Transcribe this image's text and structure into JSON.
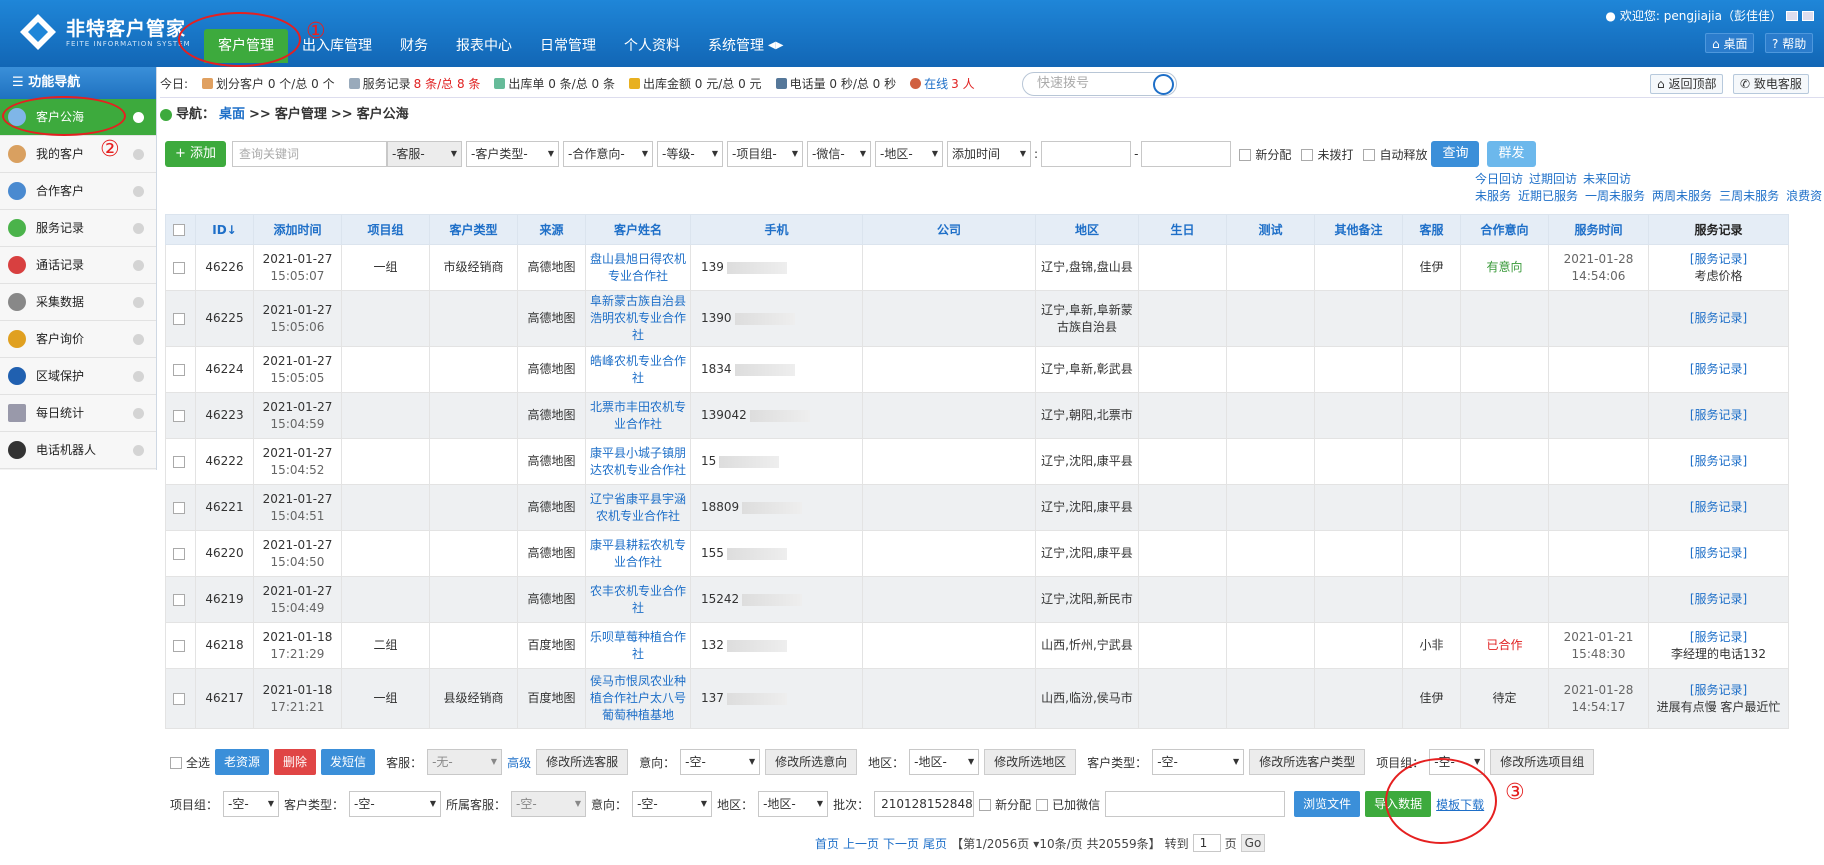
{
  "app": {
    "title": "非特客户管家",
    "subtitle": "FEITE INFORMATION SYSTEM"
  },
  "nav": {
    "tabs": [
      "客户管理",
      "出入库管理",
      "财务",
      "报表中心",
      "日常管理",
      "个人资料",
      "系统管理"
    ],
    "active": "客户管理"
  },
  "header": {
    "welcome": "欢迎您: pengjiajia（彭佳佳）",
    "desktop": "桌面",
    "help": "帮助"
  },
  "sidebar": {
    "title": "功能导航",
    "items": [
      "客户公海",
      "我的客户",
      "合作客户",
      "服务记录",
      "通话记录",
      "采集数据",
      "客户询价",
      "区域保护",
      "每日统计",
      "电话机器人"
    ],
    "active": "客户公海"
  },
  "stats": {
    "today": "今日:",
    "assign": "划分客户 0 个/总 0 个",
    "service_label": "服务记录",
    "service_val": "8 条/总 8 条",
    "outbound": "出库单 0 条/总 0 条",
    "amount": "出库金额 0 元/总 0 元",
    "calls": "电话量 0 秒/总 0 秒",
    "online_label": "在线",
    "online_val": "3 人"
  },
  "dial": {
    "placeholder": "快速拨号"
  },
  "right_buttons": {
    "back_top": "返回顶部",
    "call_service": "致电客服"
  },
  "breadcrumb": {
    "label": "导航：",
    "home": "桌面",
    "sep": ">>",
    "p1": "客户管理",
    "p2": "客户公海"
  },
  "filters": {
    "add": "+ 添加",
    "keyword_placeholder": "查询关键词",
    "selects": [
      "-客服-",
      "-客户类型-",
      "-合作意向-",
      "-等级-",
      "-项目组-",
      "-微信-",
      "-地区-",
      "添加时间"
    ],
    "colon": ":",
    "dash": "-",
    "checks": [
      "新分配",
      "未拨打",
      "自动释放"
    ],
    "query": "查询",
    "bulk": "群发"
  },
  "quick_links": {
    "row1": [
      "今日回访",
      "过期回访",
      "未来回访"
    ],
    "row2": [
      "未服务",
      "近期已服务",
      "一周未服务",
      "两周未服务",
      "三周未服务",
      "浪费资"
    ]
  },
  "table": {
    "headers": [
      "ID↓",
      "添加时间",
      "项目组",
      "客户类型",
      "来源",
      "客户姓名",
      "手机",
      "公司",
      "地区",
      "生日",
      "测试",
      "其他备注",
      "客服",
      "合作意向",
      "服务时间",
      "服务记录"
    ],
    "rows": [
      {
        "id": "46226",
        "date": "2021-01-27",
        "time": "15:05:07",
        "group": "一组",
        "type": "市级经销商",
        "src": "高德地图",
        "name": "盘山县旭日得农机专业合作社",
        "phone": "139",
        "region": "辽宁,盘锦,盘山县",
        "cs": "佳伊",
        "intent": "有意向",
        "sdate": "2021-01-28",
        "stime": "14:54:06",
        "rec": "[服务记录]",
        "note": "考虑价格"
      },
      {
        "id": "46225",
        "date": "2021-01-27",
        "time": "15:05:06",
        "group": "",
        "type": "",
        "src": "高德地图",
        "name": "阜新蒙古族自治县浩明农机专业合作社",
        "phone": "1390",
        "region": "辽宁,阜新,阜新蒙古族自治县",
        "cs": "",
        "intent": "",
        "sdate": "",
        "stime": "",
        "rec": "[服务记录]",
        "note": ""
      },
      {
        "id": "46224",
        "date": "2021-01-27",
        "time": "15:05:05",
        "group": "",
        "type": "",
        "src": "高德地图",
        "name": "皓峰农机专业合作社",
        "phone": "1834",
        "region": "辽宁,阜新,彰武县",
        "cs": "",
        "intent": "",
        "sdate": "",
        "stime": "",
        "rec": "[服务记录]",
        "note": ""
      },
      {
        "id": "46223",
        "date": "2021-01-27",
        "time": "15:04:59",
        "group": "",
        "type": "",
        "src": "高德地图",
        "name": "北票市丰田农机专业合作社",
        "phone": "139042",
        "region": "辽宁,朝阳,北票市",
        "cs": "",
        "intent": "",
        "sdate": "",
        "stime": "",
        "rec": "[服务记录]",
        "note": ""
      },
      {
        "id": "46222",
        "date": "2021-01-27",
        "time": "15:04:52",
        "group": "",
        "type": "",
        "src": "高德地图",
        "name": "康平县小城子镇朋达农机专业合作社",
        "phone": "15",
        "region": "辽宁,沈阳,康平县",
        "cs": "",
        "intent": "",
        "sdate": "",
        "stime": "",
        "rec": "[服务记录]",
        "note": ""
      },
      {
        "id": "46221",
        "date": "2021-01-27",
        "time": "15:04:51",
        "group": "",
        "type": "",
        "src": "高德地图",
        "name": "辽宁省康平县宇涵农机专业合作社",
        "phone": "18809",
        "region": "辽宁,沈阳,康平县",
        "cs": "",
        "intent": "",
        "sdate": "",
        "stime": "",
        "rec": "[服务记录]",
        "note": ""
      },
      {
        "id": "46220",
        "date": "2021-01-27",
        "time": "15:04:50",
        "group": "",
        "type": "",
        "src": "高德地图",
        "name": "康平县耕耘农机专业合作社",
        "phone": "155",
        "region": "辽宁,沈阳,康平县",
        "cs": "",
        "intent": "",
        "sdate": "",
        "stime": "",
        "rec": "[服务记录]",
        "note": ""
      },
      {
        "id": "46219",
        "date": "2021-01-27",
        "time": "15:04:49",
        "group": "",
        "type": "",
        "src": "高德地图",
        "name": "农丰农机专业合作社",
        "phone": "15242",
        "region": "辽宁,沈阳,新民市",
        "cs": "",
        "intent": "",
        "sdate": "",
        "stime": "",
        "rec": "[服务记录]",
        "note": ""
      },
      {
        "id": "46218",
        "date": "2021-01-18",
        "time": "17:21:29",
        "group": "二组",
        "type": "",
        "src": "百度地图",
        "name": "乐呗草莓种植合作社",
        "phone": "132",
        "region": "山西,忻州,宁武县",
        "cs": "小非",
        "intent": "已合作",
        "sdate": "2021-01-21",
        "stime": "15:48:30",
        "rec": "[服务记录]",
        "note": "李经理的电话132"
      },
      {
        "id": "46217",
        "date": "2021-01-18",
        "time": "17:21:21",
        "group": "一组",
        "type": "县级经销商",
        "src": "百度地图",
        "name": "侯马市恨凤农业种植合作社户太八号葡萄种植基地",
        "phone": "137",
        "region": "山西,临汾,侯马市",
        "cs": "佳伊",
        "intent": "待定",
        "sdate": "2021-01-28",
        "stime": "14:54:17",
        "rec": "[服务记录]",
        "note": "进展有点慢 客户最近忙"
      }
    ]
  },
  "actions1": {
    "select_all": "全选",
    "old": "老资源",
    "delete": "删除",
    "sms": "发短信",
    "cs_label": "客服：",
    "cs_val": "-无-",
    "advanced": "高级",
    "mod_cs": "修改所选客服",
    "intent_label": "意向：",
    "intent_val": "-空-",
    "mod_intent": "修改所选意向",
    "region_label": "地区：",
    "region_val": "-地区-",
    "mod_region": "修改所选地区",
    "type_label": "客户类型：",
    "type_val": "-空-",
    "mod_type": "修改所选客户类型",
    "group_label": "项目组：",
    "group_val": "-空-",
    "mod_group": "修改所选项目组"
  },
  "actions2": {
    "group_label": "项目组：",
    "group_val": "-空-",
    "type_label": "客户类型：",
    "type_val": "-空-",
    "owner_label": "所属客服：",
    "owner_val": "-空-",
    "intent_label": "意向：",
    "intent_val": "-空-",
    "region_label": "地区：",
    "region_val": "-地区-",
    "batch_label": "批次：",
    "batch_val": "210128152848",
    "new_chk": "新分配",
    "wx_chk": "已加微信",
    "browse": "浏览文件",
    "import": "导入数据",
    "template": "模板下载"
  },
  "pager": {
    "first": "首页",
    "prev": "上一页",
    "next": "下一页",
    "last": "尾页",
    "info": "【第1/2056页",
    "per": "10条/页 共20559条】",
    "goto": "转到",
    "page": "1",
    "unit": "页",
    "go": "Go"
  },
  "annotations": [
    "①",
    "②",
    "③"
  ]
}
